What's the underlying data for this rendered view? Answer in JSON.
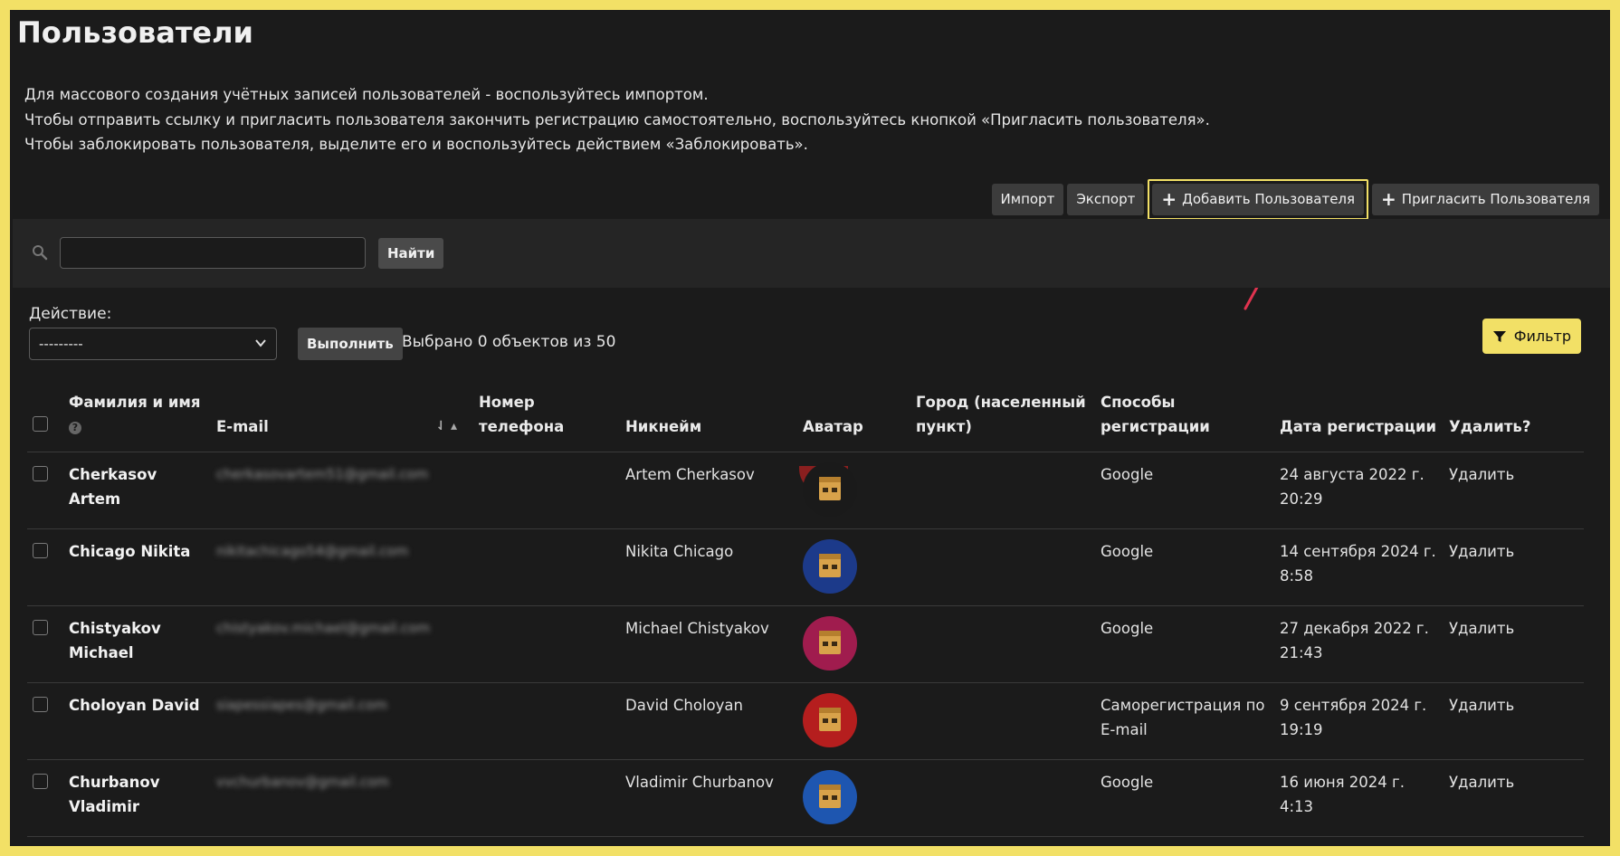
{
  "page": {
    "title": "Пользователи",
    "help": [
      "Для массового создания учётных записей пользователей - воспользуйтесь импортом.",
      "Чтобы отправить ссылку и пригласить пользователя закончить регистрацию самостоятельно, воспользуйтесь кнопкой «Пригласить пользователя».",
      "Чтобы заблокировать пользователя, выделите его и воспользуйтесь действием «Заблокировать»."
    ]
  },
  "toolbar": {
    "import_label": "Импорт",
    "export_label": "Экспорт",
    "add_user_label": "Добавить Пользователя",
    "invite_user_label": "Пригласить Пользователя"
  },
  "search": {
    "value": "",
    "button_label": "Найти"
  },
  "actions": {
    "label": "Действие:",
    "selected": "---------",
    "run_label": "Выполнить",
    "selection_text": "Выбрано 0 объектов из 50"
  },
  "filter": {
    "label": "Фильтр"
  },
  "table": {
    "headers": {
      "name": "Фамилия и имя",
      "email": "E-mail",
      "phone": "Номер телефона",
      "nickname": "Никнейм",
      "avatar": "Аватар",
      "city": "Город (населенный пункт)",
      "registration_methods": "Способы регистрации",
      "registration_date": "Дата регистрации",
      "delete": "Удалить?"
    },
    "sort_indicator": "⇃ ▴",
    "rows": [
      {
        "name": "Cherkasov Artem",
        "email": "cherkasovartem51@gmail.com",
        "phone": "",
        "nickname": "Artem Cherkasov",
        "avatar_color": "#1a1a1a",
        "city": "",
        "method": "Google",
        "date": "24 августа 2022 г. 20:29",
        "delete": "Удалить"
      },
      {
        "name": "Chicago Nikita",
        "email": "nikitachicago54@gmail.com",
        "phone": "",
        "nickname": "Nikita Chicago",
        "avatar_color": "#1c3a8a",
        "city": "",
        "method": "Google",
        "date": "14 сентября 2024 г. 8:58",
        "delete": "Удалить"
      },
      {
        "name": "Chistyakov Michael",
        "email": "chistyakov.michael@gmail.com",
        "phone": "",
        "nickname": "Michael Chistyakov",
        "avatar_color": "#a01c4e",
        "city": "",
        "method": "Google",
        "date": "27 декабря 2022 г. 21:43",
        "delete": "Удалить"
      },
      {
        "name": "Choloyan David",
        "email": "siapessiapes@gmail.com",
        "phone": "",
        "nickname": "David Choloyan",
        "avatar_color": "#b51e1e",
        "city": "",
        "method": "Саморегистрация по E-mail",
        "date": "9 сентября 2024 г. 19:19",
        "delete": "Удалить"
      },
      {
        "name": "Churbanov Vladimir",
        "email": "vvchurbanov@gmail.com",
        "phone": "",
        "nickname": "Vladimir Churbanov",
        "avatar_color": "#1e56b0",
        "city": "",
        "method": "Google",
        "date": "16 июня 2024 г. 4:13",
        "delete": "Удалить"
      }
    ]
  },
  "colors": {
    "accent": "#f2e066",
    "background": "#1b1b1b",
    "arrow": "#e0334f"
  }
}
